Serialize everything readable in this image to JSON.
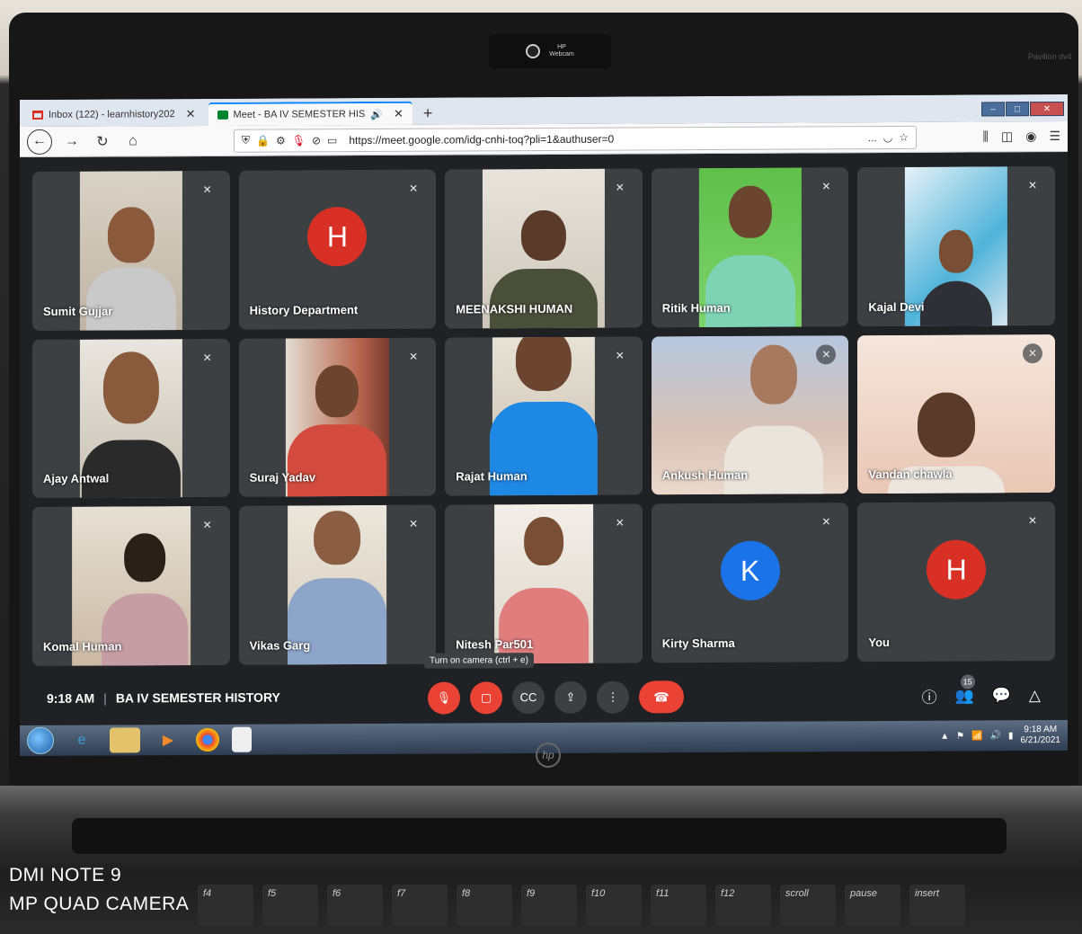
{
  "browser": {
    "tabs": [
      {
        "label": "Inbox (122) - learnhistory202",
        "active": false
      },
      {
        "label": "Meet - BA IV SEMESTER HIS",
        "active": true
      }
    ],
    "new_tab_label": "+",
    "url": "https://meet.google.com/idg-cnhi-toq?pli=1&authuser=0",
    "page_actions": "..."
  },
  "participants": [
    {
      "name": "Sumit Gujjar",
      "avatar": null
    },
    {
      "name": "History Department",
      "avatar": "H",
      "avatar_color": "#d93025"
    },
    {
      "name": "MEENAKSHI HUMAN",
      "avatar": null
    },
    {
      "name": "Ritik Human",
      "avatar": null
    },
    {
      "name": "Kajal Devi",
      "avatar": null
    },
    {
      "name": "Ajay Antwal",
      "avatar": null
    },
    {
      "name": "Suraj Yadav",
      "avatar": null
    },
    {
      "name": "Rajat Human",
      "avatar": null
    },
    {
      "name": "Ankush Human",
      "avatar": null
    },
    {
      "name": "Vandan chawla",
      "avatar": null
    },
    {
      "name": "Komal Human",
      "avatar": null
    },
    {
      "name": "Vikas Garg",
      "avatar": null
    },
    {
      "name": "Nitesh Par501",
      "avatar": null
    },
    {
      "name": "Kirty Sharma",
      "avatar": "K",
      "avatar_color": "#1a73e8"
    },
    {
      "name": "You",
      "avatar": "H",
      "avatar_color": "#d93025"
    }
  ],
  "meeting": {
    "time": "9:18 AM",
    "separator": "|",
    "title": "BA IV SEMESTER HISTORY",
    "tooltip": "Turn on camera (ctrl + e)",
    "participant_count": "15"
  },
  "taskbar": {
    "clock_time": "9:18 AM",
    "clock_date": "6/21/2021"
  },
  "laptop": {
    "webcam_label_1": "HP",
    "webcam_label_2": "Webcam",
    "brand": "Pavilion dv4",
    "logo": "hp"
  },
  "watermark": {
    "line1": "DMI NOTE 9",
    "line2": "MP QUAD CAMERA"
  },
  "keyboard": [
    "f4",
    "f5",
    "f6",
    "f7",
    "f8",
    "f9",
    "f10",
    "f11",
    "f12",
    "scroll",
    "pause",
    "insert"
  ]
}
